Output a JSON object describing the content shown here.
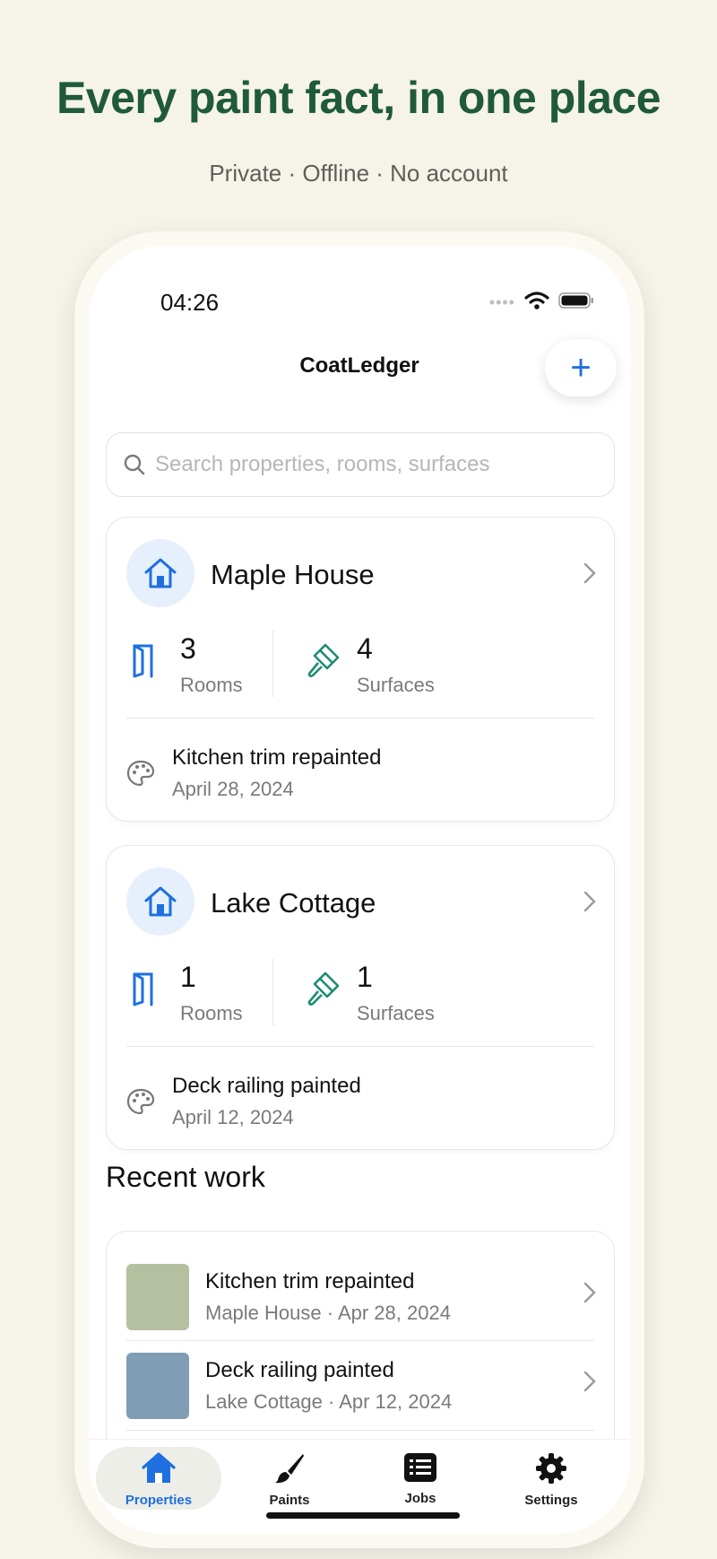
{
  "promo": {
    "headline": "Every paint fact, in one place",
    "subline": "Private · Offline · No account"
  },
  "status": {
    "time": "04:26",
    "dots": "••••"
  },
  "nav": {
    "title": "CoatLedger",
    "add_label": "+"
  },
  "search": {
    "placeholder": "Search properties, rooms, surfaces"
  },
  "properties": [
    {
      "name": "Maple House",
      "rooms_count": "3",
      "rooms_label": "Rooms",
      "surfaces_count": "4",
      "surfaces_label": "Surfaces",
      "last_job": "Kitchen trim repainted",
      "last_date": "April 28, 2024"
    },
    {
      "name": "Lake Cottage",
      "rooms_count": "1",
      "rooms_label": "Rooms",
      "surfaces_count": "1",
      "surfaces_label": "Surfaces",
      "last_job": "Deck railing painted",
      "last_date": "April 12, 2024"
    }
  ],
  "recent": {
    "title": "Recent work",
    "items": [
      {
        "title": "Kitchen trim repainted",
        "subtitle": "Maple House · Apr 28, 2024",
        "swatch": "#b4c09f"
      },
      {
        "title": "Deck railing painted",
        "subtitle": "Lake Cottage · Apr 12, 2024",
        "swatch": "#7f9db5"
      }
    ]
  },
  "tabs": [
    {
      "label": "Properties",
      "icon": "house-icon",
      "active": true
    },
    {
      "label": "Paints",
      "icon": "brush-icon",
      "active": false
    },
    {
      "label": "Jobs",
      "icon": "list-icon",
      "active": false
    },
    {
      "label": "Settings",
      "icon": "gear-icon",
      "active": false
    }
  ],
  "colors": {
    "accent": "#1e6fe0",
    "brand_green": "#1f5a3c",
    "background": "#f6f3e9",
    "surface_icon": "#1c8c73"
  }
}
